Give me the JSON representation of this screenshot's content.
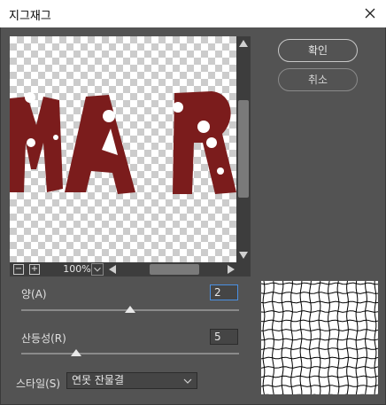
{
  "window": {
    "title": "지그재그"
  },
  "buttons": {
    "ok": "확인",
    "cancel": "취소"
  },
  "preview": {
    "zoom": "100%",
    "zoom_out": "−",
    "zoom_in": "+"
  },
  "params": {
    "amount": {
      "label": "양(A)",
      "value": "2",
      "fraction": 0.5
    },
    "ridges": {
      "label": "산등성(R)",
      "value": "5",
      "fraction": 0.25
    }
  },
  "style": {
    "label": "스타일(S)",
    "selected": "연못 잔물결"
  },
  "colors": {
    "letter": "#7b1c1c",
    "focus": "#4a90e2"
  }
}
